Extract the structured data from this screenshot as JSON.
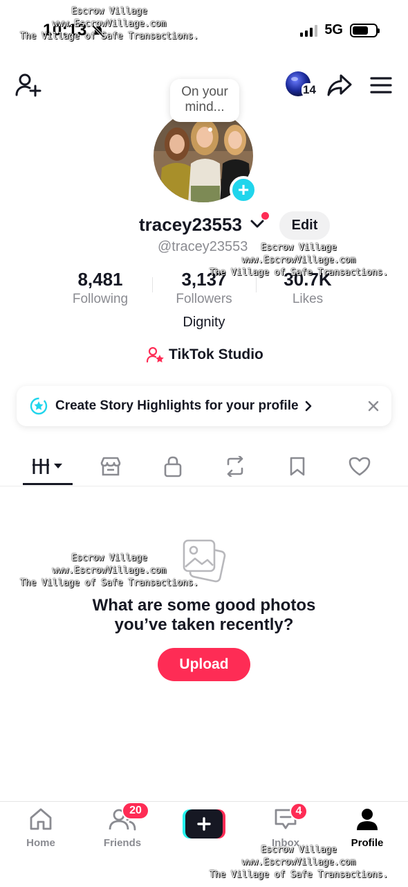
{
  "status_bar": {
    "time": "10:13",
    "network": "5G"
  },
  "watermark": {
    "line1": "Escrow Village",
    "line2": "www.EscrowVillage.com",
    "line3": "The Village of Safe Transactions."
  },
  "top_bar": {
    "story_count": "14"
  },
  "profile": {
    "thought_bubble": "On your mind...",
    "username": "tracey23553",
    "edit_label": "Edit",
    "handle": "@tracey23553",
    "stats": [
      {
        "value": "8,481",
        "label": "Following"
      },
      {
        "value": "3,137",
        "label": "Followers"
      },
      {
        "value": "30.7K",
        "label": "Likes"
      }
    ],
    "bio": "Dignity",
    "studio_label": "TikTok Studio"
  },
  "banner": {
    "text": "Create Story Highlights for your profile"
  },
  "tabs": [
    "videos-grid",
    "shop",
    "private",
    "reposts",
    "favorites",
    "liked"
  ],
  "empty_state": {
    "line1": "What are some good photos",
    "line2": "you’ve taken recently?",
    "button": "Upload"
  },
  "bottom_nav": {
    "home": "Home",
    "friends": "Friends",
    "friends_badge": "20",
    "inbox": "Inbox",
    "inbox_badge": "4",
    "profile": "Profile"
  },
  "colors": {
    "accent": "#fe2c55",
    "cyan": "#20d5ec",
    "text": "#161823",
    "muted": "#8a8b91"
  }
}
